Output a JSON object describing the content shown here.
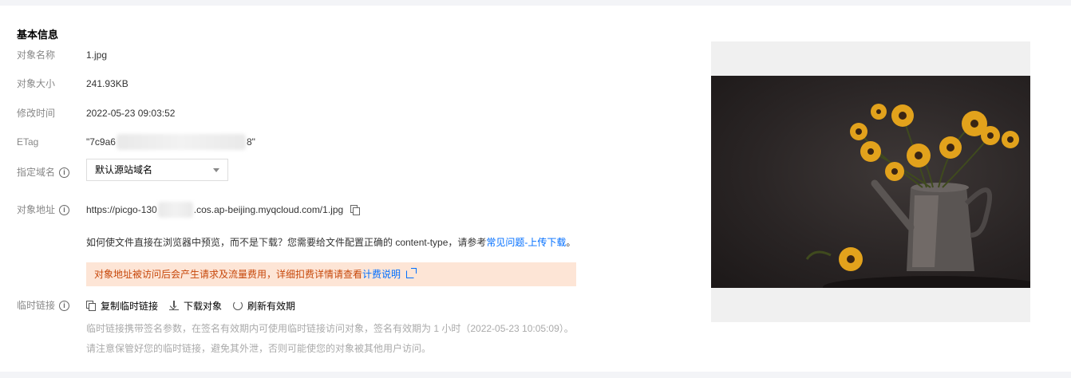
{
  "section": {
    "title": "基本信息"
  },
  "fields": {
    "name": {
      "label": "对象名称",
      "value": "1.jpg"
    },
    "size": {
      "label": "对象大小",
      "value": "241.93KB"
    },
    "modified": {
      "label": "修改时间",
      "value": "2022-05-23 09:03:52"
    },
    "etag": {
      "label": "ETag",
      "prefix": "\"7c9a6",
      "suffix": "8\""
    },
    "domain": {
      "label": "指定域名",
      "selected": "默认源站域名"
    },
    "address": {
      "label": "对象地址",
      "prefix": "https://picgo-130",
      "suffix": ".cos.ap-beijing.myqcloud.com/1.jpg"
    }
  },
  "hint": {
    "text": "如何使文件直接在浏览器中预览，而不是下载？您需要给文件配置正确的 content-type，请参考",
    "link": "常见问题-上传下载",
    "end": "。"
  },
  "warning": {
    "text": "对象地址被访问后会产生请求及流量费用，详细扣费详情请查看",
    "link": "计费说明"
  },
  "temp_link": {
    "label": "临时链接",
    "actions": {
      "copy": "复制临时链接",
      "download": "下载对象",
      "refresh": "刷新有效期"
    },
    "note1": "临时链接携带签名参数，在签名有效期内可使用临时链接访问对象，签名有效期为 1 小时（2022-05-23 10:05:09）。",
    "note2": "请注意保管好您的临时链接，避免其外泄，否则可能使您的对象被其他用户访问。"
  },
  "colors": {
    "link": "#006eff",
    "warning_bg": "#fde5d6",
    "warning_text": "#c7480b"
  },
  "icons": [
    "info-icon",
    "copy-icon",
    "external-link-icon",
    "download-icon",
    "refresh-icon",
    "chevron-down-icon"
  ]
}
